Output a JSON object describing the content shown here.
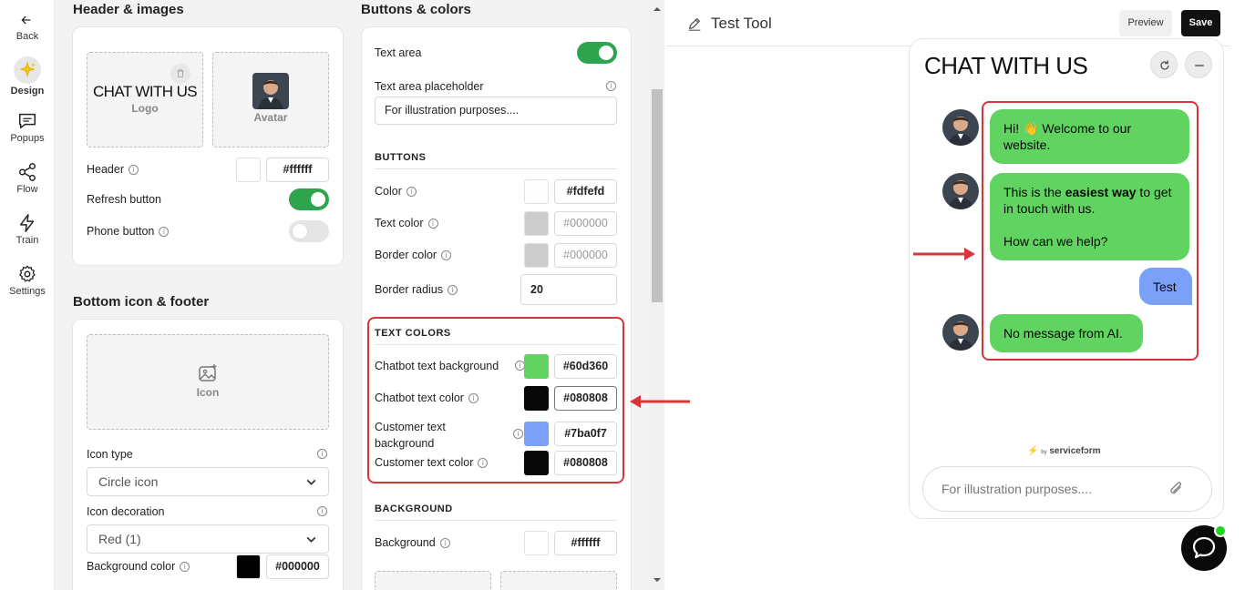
{
  "rail": {
    "back": "Back",
    "items": [
      {
        "label": "Design",
        "icon": "sparkle-icon"
      },
      {
        "label": "Popups",
        "icon": "message-icon"
      },
      {
        "label": "Flow",
        "icon": "share-icon"
      },
      {
        "label": "Train",
        "icon": "lightning-icon"
      },
      {
        "label": "Settings",
        "icon": "gear-icon"
      }
    ]
  },
  "header_images": {
    "title": "Header & images",
    "logo_text": "CHAT WITH US",
    "logo_label": "Logo",
    "avatar_label": "Avatar",
    "header_label": "Header",
    "header_color": "#ffffff",
    "refresh_label": "Refresh button",
    "refresh_on": true,
    "phone_label": "Phone button",
    "phone_on": false
  },
  "bottom": {
    "title": "Bottom icon & footer",
    "icon_label": "Icon",
    "icon_type_label": "Icon type",
    "icon_type_value": "Circle icon",
    "icon_decoration_label": "Icon decoration",
    "icon_decoration_value": "Red (1)",
    "bg_color_label": "Background color",
    "bg_color_value": "#000000"
  },
  "buttons_colors": {
    "title": "Buttons & colors",
    "text_area_label": "Text area",
    "text_area_on": true,
    "placeholder_label": "Text area placeholder",
    "placeholder_value": "For illustration purposes....",
    "buttons_group": "BUTTONS",
    "color_label": "Color",
    "color_value": "#fdfefd",
    "text_color_label": "Text color",
    "text_color_value": "#000000",
    "border_color_label": "Border color",
    "border_color_value": "#000000",
    "border_radius_label": "Border radius",
    "border_radius_value": "20",
    "text_colors_group": "TEXT COLORS",
    "chatbot_bg_label": "Chatbot text background",
    "chatbot_bg_value": "#60d360",
    "chatbot_text_label": "Chatbot text color",
    "chatbot_text_value": "#080808",
    "customer_bg_label": "Customer text background",
    "customer_bg_value": "#7ba0f7",
    "customer_text_label": "Customer text color",
    "customer_text_value": "#080808",
    "background_group": "BACKGROUND",
    "background_label": "Background",
    "background_value": "#ffffff"
  },
  "topbar": {
    "title": "Test Tool",
    "preview": "Preview",
    "save": "Save"
  },
  "chat": {
    "title": "CHAT WITH US",
    "msg1": "Hi! 👋 Welcome to our website.",
    "msg2_pre": "This is the ",
    "msg2_bold": "easiest way",
    "msg2_post": " to get in touch with us.",
    "msg2_line2": "How can we help?",
    "customer_msg": "Test",
    "msg3": "No message from AI.",
    "brand": "servicefᴐrm",
    "brand_by": "by",
    "input_placeholder": "For illustration purposes...."
  }
}
